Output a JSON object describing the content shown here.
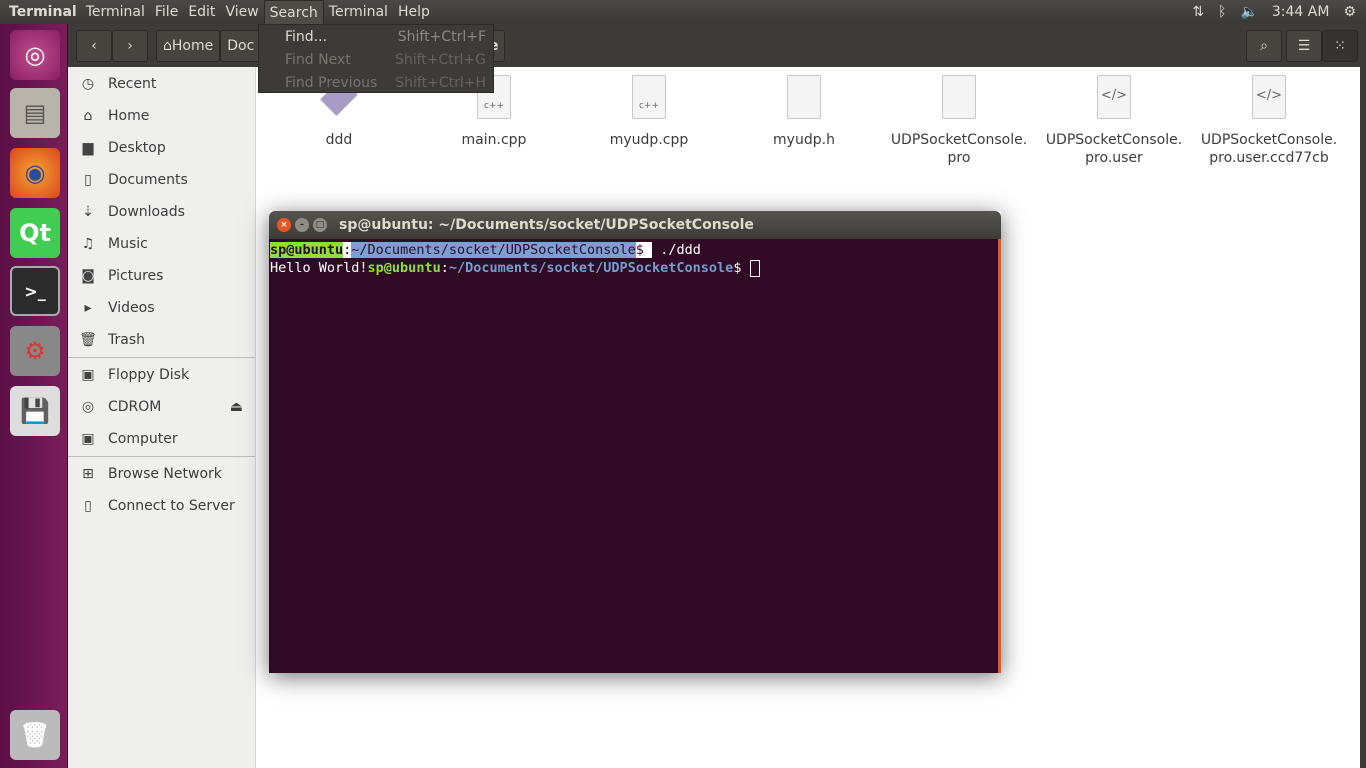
{
  "panel": {
    "app_title": "Terminal",
    "menus": [
      "Terminal",
      "File",
      "Edit",
      "View",
      "Search",
      "Terminal",
      "Help"
    ],
    "active_menu": "Search",
    "clock": "3:44 AM"
  },
  "search_menu": {
    "items": [
      {
        "label": "Find...",
        "shortcut": "Shift+Ctrl+F",
        "enabled": true
      },
      {
        "label": "Find Next",
        "shortcut": "Shift+Ctrl+G",
        "enabled": false
      },
      {
        "label": "Find Previous",
        "shortcut": "Shift+Ctrl+H",
        "enabled": false
      }
    ]
  },
  "launcher": {
    "items": [
      "ubuntu-dash-icon",
      "files-icon",
      "firefox-icon",
      "qt-creator-icon",
      "terminal-icon",
      "system-settings-icon",
      "floppy-icon"
    ],
    "trash": "trash-icon",
    "qt_label": "Qt"
  },
  "toolbar": {
    "breadcrumb": [
      "Home",
      "Doc",
      "sole"
    ]
  },
  "sidebar": {
    "items": [
      {
        "label": "Recent",
        "icon": "clock-icon"
      },
      {
        "label": "Home",
        "icon": "home-icon"
      },
      {
        "label": "Desktop",
        "icon": "folder-icon"
      },
      {
        "label": "Documents",
        "icon": "document-icon"
      },
      {
        "label": "Downloads",
        "icon": "download-icon"
      },
      {
        "label": "Music",
        "icon": "music-icon"
      },
      {
        "label": "Pictures",
        "icon": "camera-icon"
      },
      {
        "label": "Videos",
        "icon": "video-icon"
      },
      {
        "label": "Trash",
        "icon": "trash-icon"
      }
    ],
    "devices": [
      {
        "label": "Floppy Disk",
        "icon": "floppy-icon"
      },
      {
        "label": "CDROM",
        "icon": "cdrom-icon"
      },
      {
        "label": "Computer",
        "icon": "computer-icon"
      }
    ],
    "network": [
      {
        "label": "Browse Network",
        "icon": "network-icon"
      },
      {
        "label": "Connect to Server",
        "icon": "server-icon"
      }
    ]
  },
  "files": [
    {
      "name": "ddd",
      "type": "executable"
    },
    {
      "name": "main.cpp",
      "type": "c++",
      "badge": "c++"
    },
    {
      "name": "myudp.cpp",
      "type": "c++",
      "badge": "c++"
    },
    {
      "name": "myudp.h",
      "type": "header"
    },
    {
      "name": "UDPSocketConsole.\npro",
      "type": "text"
    },
    {
      "name": "UDPSocketConsole.\npro.user",
      "type": "xml",
      "badge": "</>"
    },
    {
      "name": "UDPSocketConsole.\npro.user.ccd77cb",
      "type": "xml",
      "badge": "</>"
    }
  ],
  "terminal": {
    "title": "sp@ubuntu: ~/Documents/socket/UDPSocketConsole",
    "user_host": "sp@ubuntu",
    "path": "~/Documents/socket/UDPSocketConsole",
    "command": "./ddd",
    "output": "Hello World!",
    "colors": {
      "bg": "#300a24",
      "prompt_user": "#8ae234",
      "prompt_path": "#729fcf",
      "accent": "#e95420"
    }
  }
}
